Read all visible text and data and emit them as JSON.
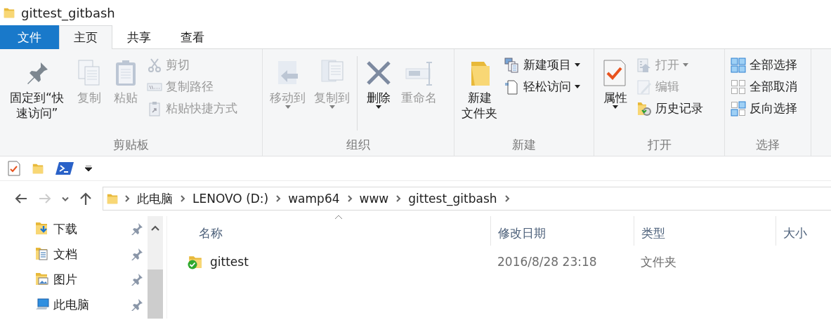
{
  "window": {
    "title": "gittest_gitbash"
  },
  "tabs": [
    {
      "label": "文件",
      "kind": "file",
      "selected": false
    },
    {
      "label": "主页",
      "kind": "tab",
      "selected": true
    },
    {
      "label": "共享",
      "kind": "tab",
      "selected": false
    },
    {
      "label": "查看",
      "kind": "tab",
      "selected": false
    }
  ],
  "ribbon": {
    "groups": [
      {
        "label": "剪贴板",
        "items": [
          {
            "label": "固定到“快速访问”",
            "kind": "large",
            "disabled": false,
            "dropdown": false
          },
          {
            "label": "复制",
            "kind": "large",
            "disabled": true,
            "dropdown": false
          },
          {
            "label": "粘贴",
            "kind": "large",
            "disabled": true,
            "dropdown": false
          },
          {
            "label": "剪切",
            "kind": "small",
            "disabled": true,
            "dropdown": false
          },
          {
            "label": "复制路径",
            "kind": "small",
            "disabled": true,
            "dropdown": false
          },
          {
            "label": "粘贴快捷方式",
            "kind": "small",
            "disabled": true,
            "dropdown": false
          }
        ]
      },
      {
        "label": "组织",
        "items": [
          {
            "label": "移动到",
            "kind": "large",
            "disabled": true,
            "dropdown": true
          },
          {
            "label": "复制到",
            "kind": "large",
            "disabled": true,
            "dropdown": true
          },
          {
            "label": "删除",
            "kind": "large",
            "disabled": false,
            "dropdown": true
          },
          {
            "label": "重命名",
            "kind": "large",
            "disabled": true,
            "dropdown": false
          }
        ]
      },
      {
        "label": "新建",
        "items": [
          {
            "label": "新建文件夹",
            "kind": "large",
            "disabled": false,
            "dropdown": false
          },
          {
            "label": "新建项目",
            "kind": "small",
            "disabled": false,
            "dropdown": true
          },
          {
            "label": "轻松访问",
            "kind": "small",
            "disabled": false,
            "dropdown": true
          }
        ]
      },
      {
        "label": "打开",
        "items": [
          {
            "label": "属性",
            "kind": "large",
            "disabled": false,
            "dropdown": true
          },
          {
            "label": "打开",
            "kind": "small",
            "disabled": true,
            "dropdown": true
          },
          {
            "label": "编辑",
            "kind": "small",
            "disabled": true,
            "dropdown": false
          },
          {
            "label": "历史记录",
            "kind": "small",
            "disabled": false,
            "dropdown": false
          }
        ]
      },
      {
        "label": "选择",
        "items": [
          {
            "label": "全部选择",
            "kind": "small",
            "disabled": false,
            "dropdown": false
          },
          {
            "label": "全部取消",
            "kind": "small",
            "disabled": false,
            "dropdown": false
          },
          {
            "label": "反向选择",
            "kind": "small",
            "disabled": false,
            "dropdown": false
          }
        ]
      }
    ]
  },
  "navigation": {
    "back_disabled": false,
    "forward_disabled": true
  },
  "breadcrumbs": [
    "此电脑",
    "LENOVO (D:)",
    "wamp64",
    "www",
    "gittest_gitbash"
  ],
  "sidebar": {
    "items": [
      {
        "label": "下载",
        "pinned": true
      },
      {
        "label": "文档",
        "pinned": true
      },
      {
        "label": "图片",
        "pinned": true
      },
      {
        "label": "此电脑",
        "pinned": true
      }
    ]
  },
  "file_list": {
    "columns": [
      {
        "label": "名称",
        "sorted": true
      },
      {
        "label": "修改日期",
        "sorted": false
      },
      {
        "label": "类型",
        "sorted": false
      },
      {
        "label": "大小",
        "sorted": false
      }
    ],
    "rows": [
      {
        "name": "gittest",
        "modified": "2016/8/28 23:18",
        "type": "文件夹",
        "synced": true
      }
    ]
  }
}
